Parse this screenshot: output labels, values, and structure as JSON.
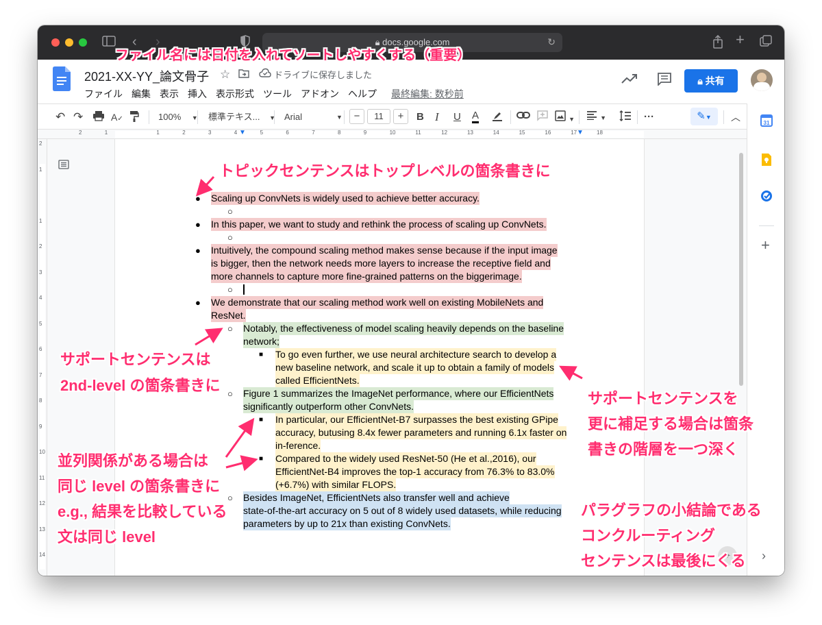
{
  "browser": {
    "url": "docs.google.com",
    "lock_icon": "lock-icon"
  },
  "doc": {
    "title": "2021-XX-YY_論文骨子",
    "save_status": "ドライブに保存しました",
    "menus": [
      "ファイル",
      "編集",
      "表示",
      "挿入",
      "表示形式",
      "ツール",
      "アドオン",
      "ヘルプ"
    ],
    "last_edit": "最終編集: 数秒前",
    "share_label": "共有",
    "brand_color": "#1a73e8"
  },
  "toolbar": {
    "zoom": "100%",
    "style": "標準テキス...",
    "font": "Arial",
    "font_size": "11",
    "minus": "−",
    "plus": "+",
    "bold": "B",
    "italic": "I",
    "underline": "U",
    "text_color": "A",
    "more": "···"
  },
  "ruler": {
    "h": [
      "2",
      "1",
      "1",
      "2",
      "3",
      "4",
      "5",
      "6",
      "7",
      "8",
      "9",
      "10",
      "11",
      "12",
      "13",
      "14",
      "15",
      "16",
      "17",
      "18"
    ],
    "v": [
      "2",
      "1",
      "1",
      "2",
      "3",
      "4",
      "5",
      "6",
      "7",
      "8",
      "9",
      "10",
      "11",
      "12",
      "13",
      "14",
      "15"
    ]
  },
  "content": {
    "l1": "Scaling up ConvNets is widely used to achieve better accuracy.",
    "l2": "In this paper, we want to study and rethink the process of scaling up ConvNets.",
    "l3a": "Intuitively, the compound scaling method makes sense because if the input image",
    "l3b": "is bigger, then the network needs more layers to increase the receptive field and",
    "l3c": "more channels to capture more fine-grained patterns on the biggerimage.",
    "l4a": "We demonstrate that our scaling method work well on existing MobileNets and",
    "l4b": "ResNet.",
    "l5a": "Notably, the effectiveness of model scaling heavily depends on the baseline",
    "l5b": "network;",
    "l6a": "To go even further, we use neural architecture search to develop a",
    "l6b": "new baseline network, and scale it up to obtain a family of models",
    "l6c": "called EfficientNets.",
    "l7a": "Figure 1 summarizes the ImageNet performance, where our EfficientNets",
    "l7b": "significantly outperform other ConvNets.",
    "l8a": "In particular, our EfficientNet-B7 surpasses the best existing GPipe",
    "l8b": "accuracy, butusing 8.4x fewer parameters and running 6.1x faster on",
    "l8c": "in-ference.",
    "l9a": "Compared to the widely used ResNet-50 (He et al.,2016),  our",
    "l9b": "EfficientNet-B4 improves the top-1 accuracy from 76.3% to 83.0%",
    "l9c": "(+6.7%) with similar FLOPS.",
    "l10a": "Besides ImageNet, EfficientNets also transfer well and achieve",
    "l10b": "state-of-the-art accuracy on 5 out of 8 widely used datasets, while reducing",
    "l10c": "parameters by up to 21x than existing ConvNets."
  },
  "annotations": {
    "title_note": "ファイル名には日付を入れてソートしやすくする（重要）",
    "topic": "トピックセンテンスはトップレベルの箇条書きに",
    "support1": "サポートセンテンスは",
    "support2": "2nd-level の箇条書きに",
    "deeper1": "サポートセンテンスを",
    "deeper2": "更に補足する場合は箇条",
    "deeper3": "書きの階層を一つ深く",
    "parallel1": "並列関係がある場合は",
    "parallel2": "同じ level の箇条書きに",
    "parallel3": "e.g., 結果を比較している",
    "parallel4": "文は同じ level",
    "concl1": "パラグラフの小結論である",
    "concl2": "コンクルーティング",
    "concl3": "センテンスは最後にくる",
    "color": "#ff2d6f"
  },
  "highlights": {
    "red": "#f4cccc",
    "green": "#d9ead3",
    "yellow": "#fff2cc",
    "blue": "#cfe2f3"
  }
}
